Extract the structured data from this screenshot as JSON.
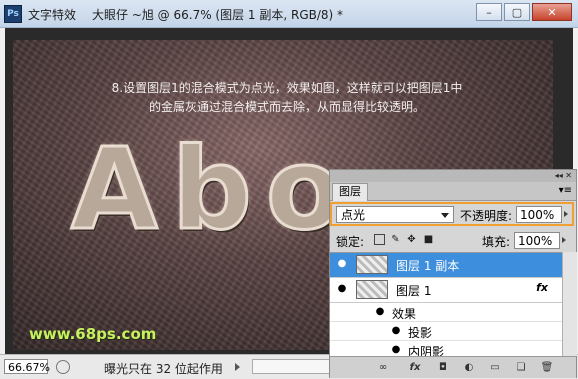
{
  "window": {
    "logo": "Ps",
    "app_title": "文字特效",
    "doc_title": "大眼仔 ~旭 @ 66.7% (图层 1 副本, RGB/8) *",
    "buttons": {
      "minimize": "–",
      "maximize": "▢",
      "close": "✕"
    }
  },
  "canvas": {
    "caption_line1": "8.设置图层1的混合模式为点光，效果如图，这样就可以把图层1中",
    "caption_line2": "的金属灰通过混合模式而去除，从而显得比较透明。",
    "letters": [
      "A",
      "b",
      "o"
    ],
    "watermark": "www.68ps.com"
  },
  "status": {
    "zoom": "66.67%",
    "message": "曝光只在 32 位起作用"
  },
  "layers_panel": {
    "collapse": "◂◂ ✕",
    "tab": "图层",
    "menu": "▾≡",
    "blend_mode": "点光",
    "opacity_label": "不透明度:",
    "opacity_value": "100%",
    "lock_label": "锁定:",
    "fill_label": "填充:",
    "fill_value": "100%",
    "layers": [
      {
        "name": "图层 1 副本",
        "selected": true,
        "fx": ""
      },
      {
        "name": "图层 1",
        "selected": false,
        "fx": "fx"
      }
    ],
    "effects_group": "效果",
    "effects": [
      "投影",
      "内阴影"
    ]
  },
  "colors": {
    "accent": "#3e8ede",
    "highlight": "#f0a030",
    "watermark": "#c8f060"
  }
}
